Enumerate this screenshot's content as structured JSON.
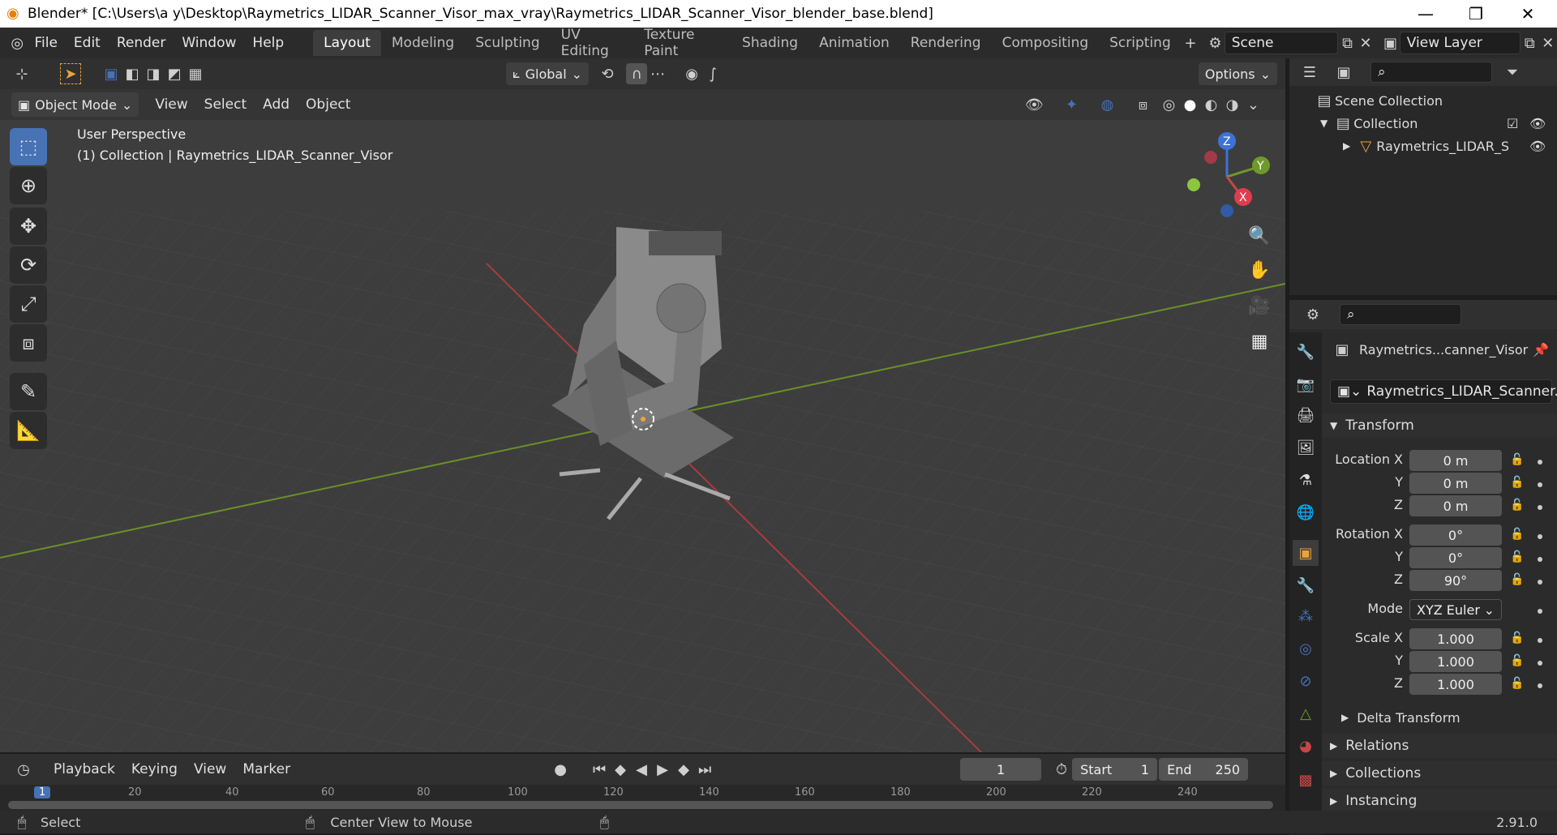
{
  "window": {
    "title": "Blender* [C:\\Users\\a y\\Desktop\\Raymetrics_LIDAR_Scanner_Visor_max_vray\\Raymetrics_LIDAR_Scanner_Visor_blender_base.blend]",
    "controls": [
      "minimize-icon",
      "maximize-icon",
      "close-icon"
    ]
  },
  "menus": [
    "File",
    "Edit",
    "Render",
    "Window",
    "Help"
  ],
  "workspaces": [
    "Layout",
    "Modeling",
    "Sculpting",
    "UV Editing",
    "Texture Paint",
    "Shading",
    "Animation",
    "Rendering",
    "Compositing",
    "Scripting"
  ],
  "active_workspace": "Layout",
  "scene": {
    "name": "Scene"
  },
  "view_layer": {
    "name": "View Layer"
  },
  "tool_header": {
    "orientation": "Global",
    "options": "Options"
  },
  "viewport_header": {
    "mode": "Object Mode",
    "menus": [
      "View",
      "Select",
      "Add",
      "Object"
    ]
  },
  "viewport": {
    "perspective": "User Perspective",
    "collection_info": "(1) Collection | Raymetrics_LIDAR_Scanner_Visor",
    "gizmo": {
      "x": "X",
      "y": "Y",
      "z": "Z"
    }
  },
  "outliner": {
    "items": [
      {
        "label": "Scene Collection"
      },
      {
        "label": "Collection"
      },
      {
        "label": "Raymetrics_LIDAR_S"
      }
    ]
  },
  "properties": {
    "object_name_short": "Raymetrics...canner_Visor",
    "object_data_name": "Raymetrics_LIDAR_Scanner...",
    "transform_header": "Transform",
    "location": {
      "label_x": "Location X",
      "x": "0 m",
      "y": "0 m",
      "z": "0 m"
    },
    "rotation": {
      "label_x": "Rotation X",
      "x": "0°",
      "y": "0°",
      "z": "90°"
    },
    "mode_label": "Mode",
    "mode_value": "XYZ Euler",
    "scale": {
      "label_x": "Scale X",
      "x": "1.000",
      "y": "1.000",
      "z": "1.000"
    },
    "axis_y": "Y",
    "axis_z": "Z",
    "sections": [
      "Delta Transform",
      "Relations",
      "Collections",
      "Instancing"
    ]
  },
  "timeline": {
    "menus": [
      "Playback",
      "Keying",
      "View",
      "Marker"
    ],
    "current_frame": "1",
    "start_label": "Start",
    "start": "1",
    "end_label": "End",
    "end": "250",
    "ruler": [
      "1",
      "20",
      "40",
      "60",
      "80",
      "100",
      "120",
      "140",
      "160",
      "180",
      "200",
      "220",
      "240"
    ]
  },
  "status_bar": {
    "left": "Select",
    "middle": "Center View to Mouse",
    "version": "2.91.0"
  },
  "colors": {
    "accent": "#4772b3",
    "x_axis": "#c84646",
    "y_axis": "#6e9a2c",
    "z_axis": "#3d72d6"
  }
}
